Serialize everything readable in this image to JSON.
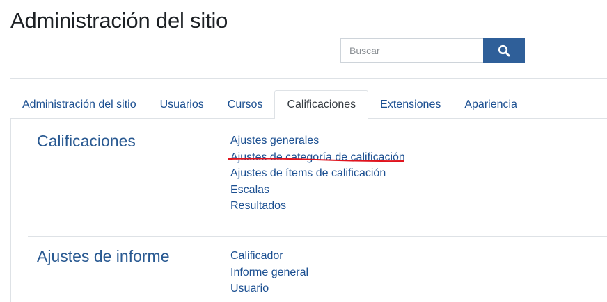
{
  "page": {
    "title": "Administración del sitio"
  },
  "search": {
    "placeholder": "Buscar",
    "value": "",
    "button_icon": "search-icon"
  },
  "tabs": [
    {
      "label": "Administración del sitio",
      "active": false
    },
    {
      "label": "Usuarios",
      "active": false
    },
    {
      "label": "Cursos",
      "active": false
    },
    {
      "label": "Calificaciones",
      "active": true
    },
    {
      "label": "Extensiones",
      "active": false
    },
    {
      "label": "Apariencia",
      "active": false
    }
  ],
  "sections": [
    {
      "heading": "Calificaciones",
      "links": [
        "Ajustes generales",
        "Ajustes de categoría de calificación",
        "Ajustes de ítems de calificación",
        "Escalas",
        "Resultados"
      ]
    },
    {
      "heading": "Ajustes de informe",
      "links": [
        "Calificador",
        "Informe general",
        "Usuario"
      ]
    }
  ],
  "colors": {
    "link": "#1b4f91",
    "heading": "#2a5a92",
    "search_button": "#2f5f99",
    "annotation": "#e0141e"
  }
}
